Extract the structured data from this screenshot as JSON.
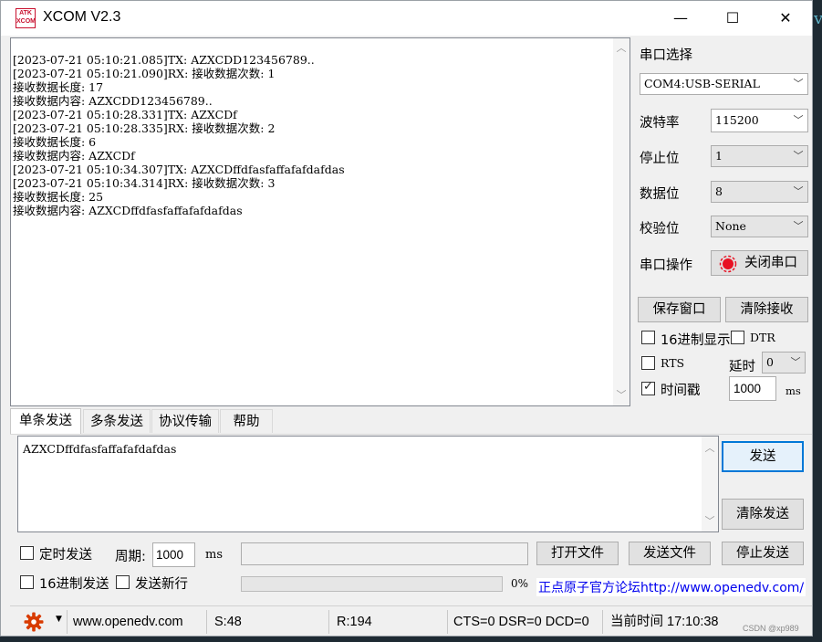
{
  "window": {
    "title": "XCOM V2.3",
    "logo_text": "ATK XCOM"
  },
  "titlebar": {
    "minimize": "—",
    "maximize": "☐",
    "close": "✕"
  },
  "receive": {
    "lines": [
      "[2023-07-21 05:10:21.085]TX: AZXCDD123456789..",
      "[2023-07-21 05:10:21.090]RX: 接收数据次数: 1",
      "接收数据长度: 17",
      "接收数据内容: AZXCDD123456789..",
      "[2023-07-21 05:10:28.331]TX: AZXCDf",
      "[2023-07-21 05:10:28.335]RX: 接收数据次数: 2",
      "接收数据长度: 6",
      "接收数据内容: AZXCDf",
      "[2023-07-21 05:10:34.307]TX: AZXCDffdfasfaffafafdafdas",
      "[2023-07-21 05:10:34.314]RX: 接收数据次数: 3",
      "接收数据长度: 25",
      "接收数据内容: AZXCDffdfasfaffafafdafdas"
    ]
  },
  "settings": {
    "port_select_label": "串口选择",
    "port_value": "COM4:USB-SERIAL",
    "baud_label": "波特率",
    "baud_value": "115200",
    "stopbits_label": "停止位",
    "stopbits_value": "1",
    "databits_label": "数据位",
    "databits_value": "8",
    "parity_label": "校验位",
    "parity_value": "None",
    "port_op_label": "串口操作",
    "close_port_button": "关闭串口",
    "save_window_button": "保存窗口",
    "clear_receive_button": "清除接收",
    "hex_display_label": "16进制显示",
    "dtr_label": "DTR",
    "rts_label": "RTS",
    "delay_label": "延时",
    "delay_value": "0",
    "timestamp_label": "时间戳",
    "timestamp_value": "1000",
    "timestamp_unit": "ms"
  },
  "tabs": [
    "单条发送",
    "多条发送",
    "协议传输",
    "帮助"
  ],
  "send": {
    "text": "AZXCDffdfasfaffafafdafdas",
    "send_button": "发送",
    "clear_send_button": "清除发送",
    "timed_send_label": "定时发送",
    "period_label": "周期:",
    "period_value": "1000",
    "period_unit": "ms",
    "open_file_button": "打开文件",
    "send_file_button": "发送文件",
    "stop_send_button": "停止发送",
    "hex_send_label": "16进制发送",
    "send_newline_label": "发送新行",
    "progress_text": "0%",
    "progress": 0,
    "forum_link": "正点原子官方论坛http://www.openedv.com/"
  },
  "status": {
    "website": "www.openedv.com",
    "sent": "S:48",
    "received": "R:194",
    "signals": "CTS=0 DSR=0 DCD=0",
    "time": "当前时间 17:10:38"
  },
  "watermark": "CSDN @xp989",
  "colors": {
    "link": "#0000ee",
    "gear": "#d83b01",
    "close_port_icon": "#e81123",
    "focus": "#0078d7"
  }
}
